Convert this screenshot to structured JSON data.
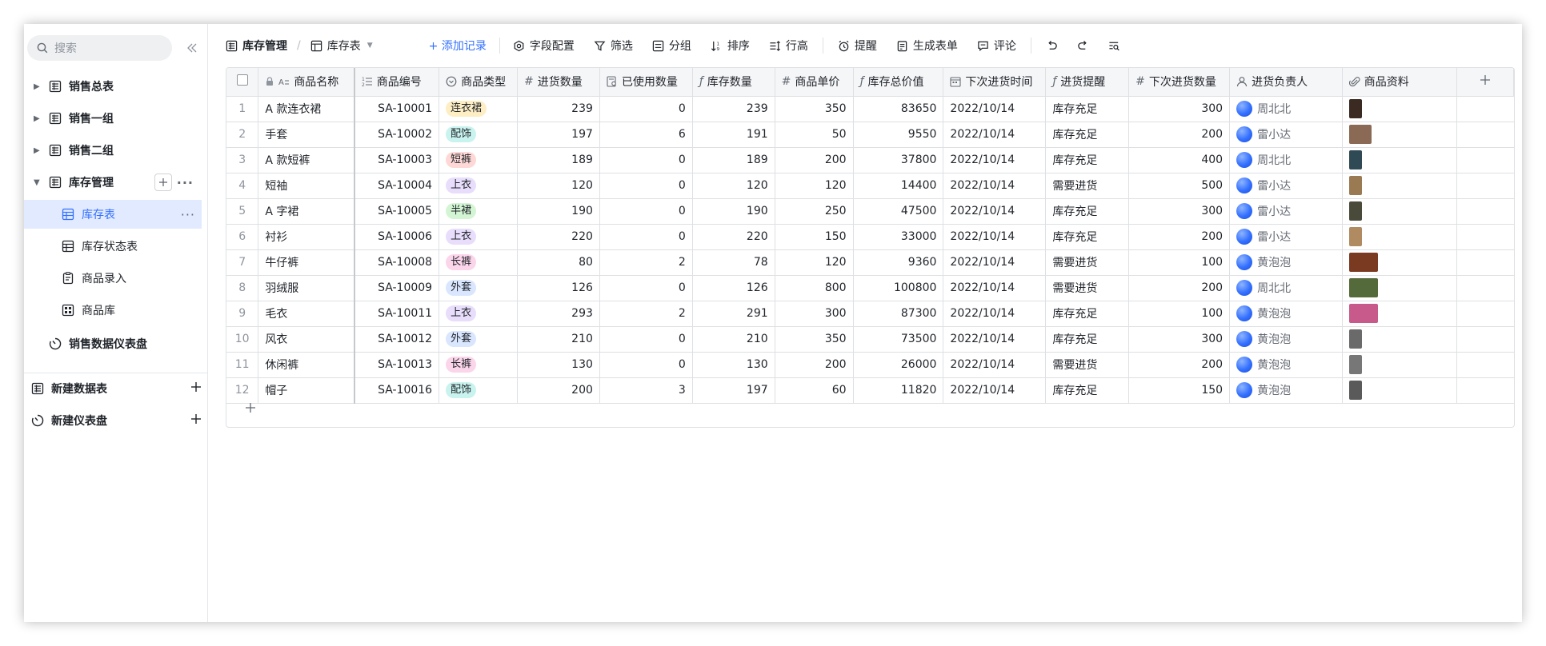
{
  "sidebar": {
    "search_placeholder": "搜索",
    "items": [
      {
        "label": "销售总表"
      },
      {
        "label": "销售一组"
      },
      {
        "label": "销售二组"
      },
      {
        "label": "库存管理"
      },
      {
        "label": "库存表"
      },
      {
        "label": "库存状态表"
      },
      {
        "label": "商品录入"
      },
      {
        "label": "商品库"
      },
      {
        "label": "销售数据仪表盘"
      }
    ],
    "new_table": "新建数据表",
    "new_dashboard": "新建仪表盘"
  },
  "toolbar": {
    "base": "库存管理",
    "view": "库存表",
    "add_record": "+ 添加记录",
    "field_config": "字段配置",
    "filter": "筛选",
    "group": "分组",
    "sort": "排序",
    "row_height": "行高",
    "reminder": "提醒",
    "generate_form": "生成表单",
    "comment": "评论"
  },
  "table": {
    "columns": [
      "商品名称",
      "商品编号",
      "商品类型",
      "进货数量",
      "已使用数量",
      "库存数量",
      "商品单价",
      "库存总价值",
      "下次进货时间",
      "进货提醒",
      "下次进货数量",
      "进货负责人",
      "商品资料"
    ],
    "rows": [
      {
        "idx": "1",
        "name": "A 款连衣裙",
        "code": "SA-10001",
        "type": "连衣裙",
        "in": "239",
        "used": "0",
        "stock": "239",
        "price": "350",
        "value": "83650",
        "date": "2022/10/14",
        "remind": "库存充足",
        "next": "300",
        "owner": "周北北"
      },
      {
        "idx": "2",
        "name": "手套",
        "code": "SA-10002",
        "type": "配饰",
        "in": "197",
        "used": "6",
        "stock": "191",
        "price": "50",
        "value": "9550",
        "date": "2022/10/14",
        "remind": "库存充足",
        "next": "200",
        "owner": "雷小达"
      },
      {
        "idx": "3",
        "name": "A 款短裤",
        "code": "SA-10003",
        "type": "短裤",
        "in": "189",
        "used": "0",
        "stock": "189",
        "price": "200",
        "value": "37800",
        "date": "2022/10/14",
        "remind": "库存充足",
        "next": "400",
        "owner": "周北北"
      },
      {
        "idx": "4",
        "name": "短袖",
        "code": "SA-10004",
        "type": "上衣",
        "in": "120",
        "used": "0",
        "stock": "120",
        "price": "120",
        "value": "14400",
        "date": "2022/10/14",
        "remind": "需要进货",
        "next": "500",
        "owner": "雷小达"
      },
      {
        "idx": "5",
        "name": "A 字裙",
        "code": "SA-10005",
        "type": "半裙",
        "in": "190",
        "used": "0",
        "stock": "190",
        "price": "250",
        "value": "47500",
        "date": "2022/10/14",
        "remind": "库存充足",
        "next": "300",
        "owner": "雷小达"
      },
      {
        "idx": "6",
        "name": "衬衫",
        "code": "SA-10006",
        "type": "上衣",
        "in": "220",
        "used": "0",
        "stock": "220",
        "price": "150",
        "value": "33000",
        "date": "2022/10/14",
        "remind": "库存充足",
        "next": "200",
        "owner": "雷小达"
      },
      {
        "idx": "7",
        "name": "牛仔裤",
        "code": "SA-10008",
        "type": "长裤",
        "in": "80",
        "used": "2",
        "stock": "78",
        "price": "120",
        "value": "9360",
        "date": "2022/10/14",
        "remind": "需要进货",
        "next": "100",
        "owner": "黄泡泡"
      },
      {
        "idx": "8",
        "name": "羽绒服",
        "code": "SA-10009",
        "type": "外套",
        "in": "126",
        "used": "0",
        "stock": "126",
        "price": "800",
        "value": "100800",
        "date": "2022/10/14",
        "remind": "需要进货",
        "next": "200",
        "owner": "周北北"
      },
      {
        "idx": "9",
        "name": "毛衣",
        "code": "SA-10011",
        "type": "上衣",
        "in": "293",
        "used": "2",
        "stock": "291",
        "price": "300",
        "value": "87300",
        "date": "2022/10/14",
        "remind": "库存充足",
        "next": "100",
        "owner": "黄泡泡"
      },
      {
        "idx": "10",
        "name": "风衣",
        "code": "SA-10012",
        "type": "外套",
        "in": "210",
        "used": "0",
        "stock": "210",
        "price": "350",
        "value": "73500",
        "date": "2022/10/14",
        "remind": "库存充足",
        "next": "300",
        "owner": "黄泡泡"
      },
      {
        "idx": "11",
        "name": "休闲裤",
        "code": "SA-10013",
        "type": "长裤",
        "in": "130",
        "used": "0",
        "stock": "130",
        "price": "200",
        "value": "26000",
        "date": "2022/10/14",
        "remind": "需要进货",
        "next": "200",
        "owner": "黄泡泡"
      },
      {
        "idx": "12",
        "name": "帽子",
        "code": "SA-10016",
        "type": "配饰",
        "in": "200",
        "used": "3",
        "stock": "197",
        "price": "60",
        "value": "11820",
        "date": "2022/10/14",
        "remind": "库存充足",
        "next": "150",
        "owner": "黄泡泡"
      }
    ]
  },
  "tag_colors": {
    "连衣裙": "#fdeec3",
    "配饰": "#c9f3ee",
    "短裤": "#fdd8d6",
    "上衣": "#e8ddfb",
    "半裙": "#d4f5d4",
    "长裤": "#fbd5ea",
    "外套": "#d9e6fd"
  },
  "thumb_colors": [
    "#3a2a22",
    "#8a6a55",
    "#2f4a55",
    "#9a7a52",
    "#4a4a3a",
    "#b08a60",
    "#7a3a22",
    "#556a3a",
    "#c75a8a",
    "#6a6a6a",
    "#777777",
    "#5a5a5a"
  ],
  "thumb_widths": [
    16,
    28,
    16,
    16,
    16,
    16,
    36,
    36,
    36,
    16,
    16,
    16
  ]
}
